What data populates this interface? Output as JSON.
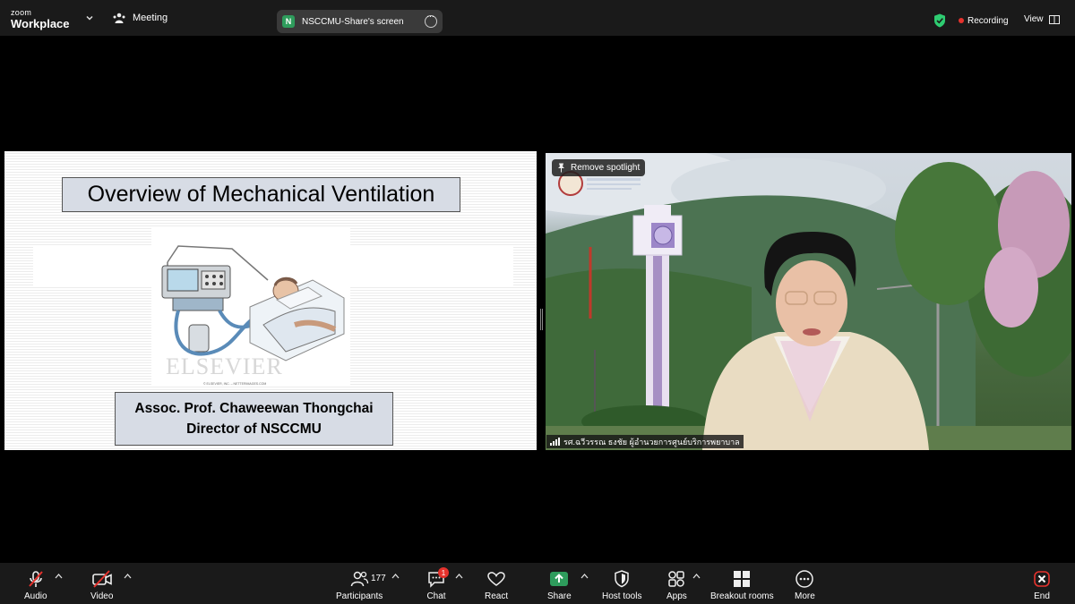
{
  "app": {
    "logo_line1": "zoom",
    "logo_line2": "Workplace"
  },
  "header": {
    "meeting_label": "Meeting",
    "share_initial": "N",
    "share_label": "NSCCMU-Share's screen",
    "recording_label": "Recording",
    "view_label": "View"
  },
  "slide": {
    "title": "Overview of Mechanical Ventilation",
    "watermark": "ELSEVIER",
    "copyright": "© ELSEVIER, INC. – NETTERIMAGES.COM",
    "presenter_name": "Assoc. Prof. Chaweewan Thongchai",
    "presenter_role": "Director of NSCCMU"
  },
  "video": {
    "spotlight_label": "Remove spotlight",
    "participant_name": "รศ.ฉวีวรรณ ธงชัย ผู้อำนวยการศูนย์บริการพยาบาล"
  },
  "toolbar": {
    "audio": "Audio",
    "video": "Video",
    "participants": "Participants",
    "participants_count": "177",
    "chat": "Chat",
    "chat_badge": "1",
    "react": "React",
    "share": "Share",
    "host_tools": "Host tools",
    "apps": "Apps",
    "breakout": "Breakout rooms",
    "more": "More",
    "end": "End"
  },
  "colors": {
    "share_green": "#2e9c5c",
    "recording_red": "#e5322d",
    "end_red": "#e5322d",
    "shield_green": "#2ecc71"
  }
}
